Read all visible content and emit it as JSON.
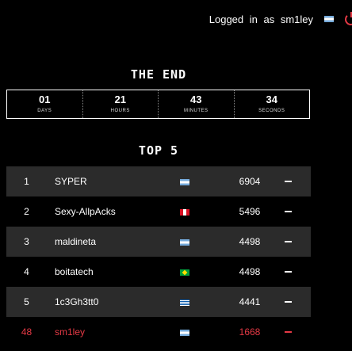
{
  "header": {
    "login_text": "Logged in as sm1ley",
    "flag": "argentina-flag",
    "logout_icon": "power-icon",
    "accent_color": "#e53945"
  },
  "countdown": {
    "title": "THE END",
    "units": [
      {
        "value": "01",
        "label": "DAYS"
      },
      {
        "value": "21",
        "label": "HOURS"
      },
      {
        "value": "43",
        "label": "MINUTES"
      },
      {
        "value": "34",
        "label": "SECONDS"
      }
    ]
  },
  "scoreboard": {
    "title": "TOP 5",
    "rows": [
      {
        "rank": "1",
        "name": "SYPER",
        "flag": "argentina-flag",
        "score": "6904"
      },
      {
        "rank": "2",
        "name": "Sexy-AllpAcks",
        "flag": "peru-flag",
        "score": "5496"
      },
      {
        "rank": "3",
        "name": "maldineta",
        "flag": "argentina-flag",
        "score": "4498"
      },
      {
        "rank": "4",
        "name": "boitatech",
        "flag": "brazil-flag",
        "score": "4498"
      },
      {
        "rank": "5",
        "name": "1c3Gh3tt0",
        "flag": "greece-flag",
        "score": "4441"
      },
      {
        "rank": "48",
        "name": "sm1ley",
        "flag": "argentina-flag",
        "score": "1668"
      }
    ]
  }
}
